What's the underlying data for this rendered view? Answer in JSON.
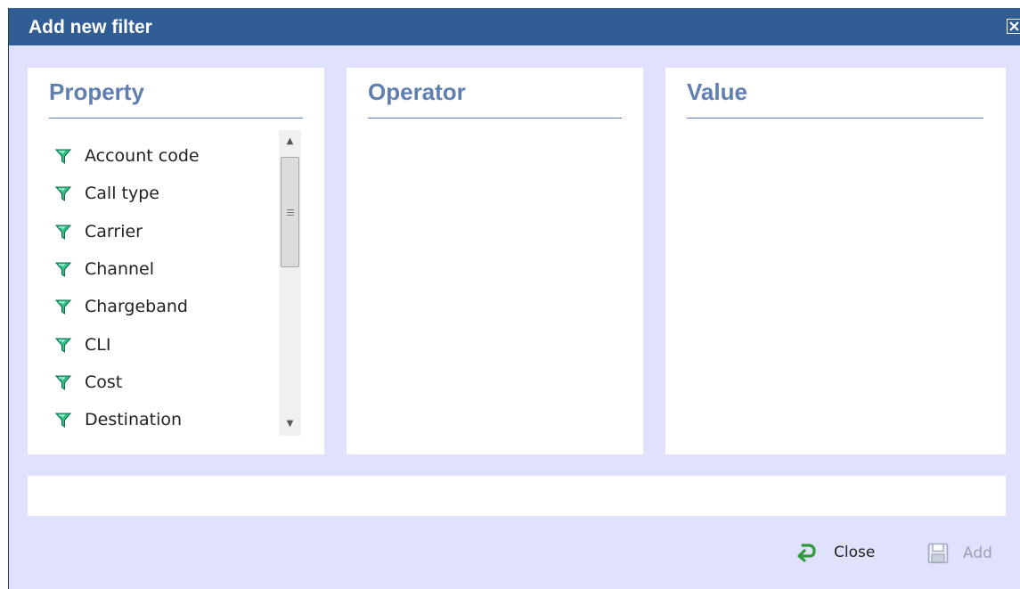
{
  "dialog": {
    "title": "Add new filter",
    "close_icon": "close-x-icon"
  },
  "columns": {
    "property": {
      "title": "Property"
    },
    "operator": {
      "title": "Operator"
    },
    "value": {
      "title": "Value"
    }
  },
  "property_list": {
    "item_icon": "filter-funnel-icon",
    "items": [
      {
        "label": "Account code"
      },
      {
        "label": "Call type"
      },
      {
        "label": "Carrier"
      },
      {
        "label": "Channel"
      },
      {
        "label": "Chargeband"
      },
      {
        "label": "CLI"
      },
      {
        "label": "Cost"
      },
      {
        "label": "Destination"
      }
    ]
  },
  "footer": {
    "close_label": "Close",
    "close_icon": "return-arrow-icon",
    "add_label": "Add",
    "add_icon": "floppy-disk-icon",
    "add_enabled": false
  },
  "colors": {
    "titlebar": "#305e94",
    "dialog_background": "#e0e2fd",
    "heading": "#5e7fb0",
    "funnel": "#2fc08a",
    "disabled_text": "#9aa0b3"
  }
}
